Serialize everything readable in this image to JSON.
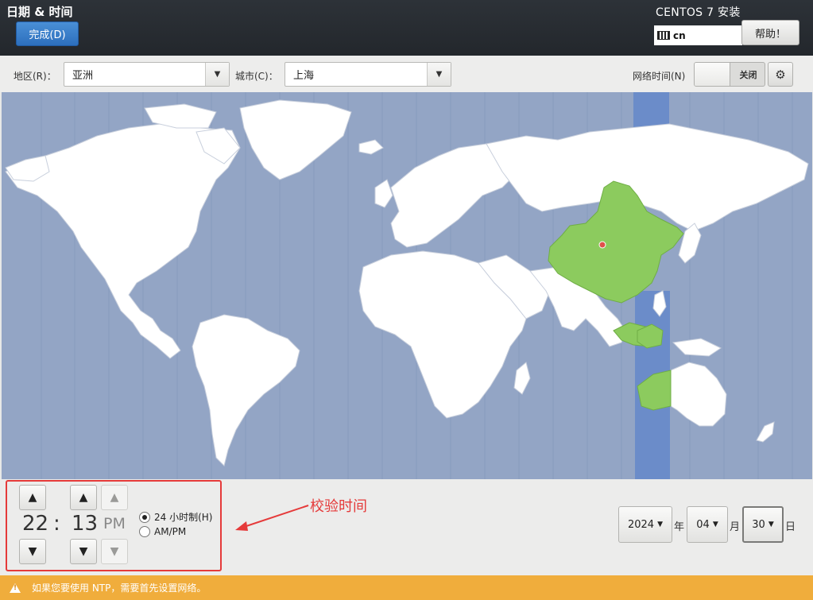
{
  "header": {
    "title": "日期 & 时间",
    "done_label": "完成(D)",
    "product": "CENTOS 7 安装",
    "keyboard_layout": "cn",
    "help_label": "帮助！"
  },
  "toolbar": {
    "region_label": "地区(R)：",
    "region_value": "亚洲",
    "city_label": "城市(C)：",
    "city_value": "上海",
    "network_time_label": "网络时间(N)",
    "network_time_state": "关闭"
  },
  "map": {
    "selected_city": "上海",
    "colors": {
      "ocean": "#93a5c5",
      "land": "#ffffff",
      "selected_zone": "#8ccb5e",
      "zone_band": "#6b8cc9",
      "pin": "#e0504a"
    }
  },
  "time": {
    "hours": "22",
    "separator": ":",
    "minutes": "13",
    "period": "PM",
    "format_24h_label": "24 小时制(H)",
    "format_ampm_label": "AM/PM",
    "format_selected": "24h"
  },
  "annotation": "校验时间",
  "date": {
    "year": "2024",
    "year_unit": "年",
    "month": "04",
    "month_unit": "月",
    "day": "30",
    "day_unit": "日"
  },
  "status": {
    "message": "如果您要使用 NTP，需要首先设置网络。",
    "color": "#f0ad3c"
  }
}
